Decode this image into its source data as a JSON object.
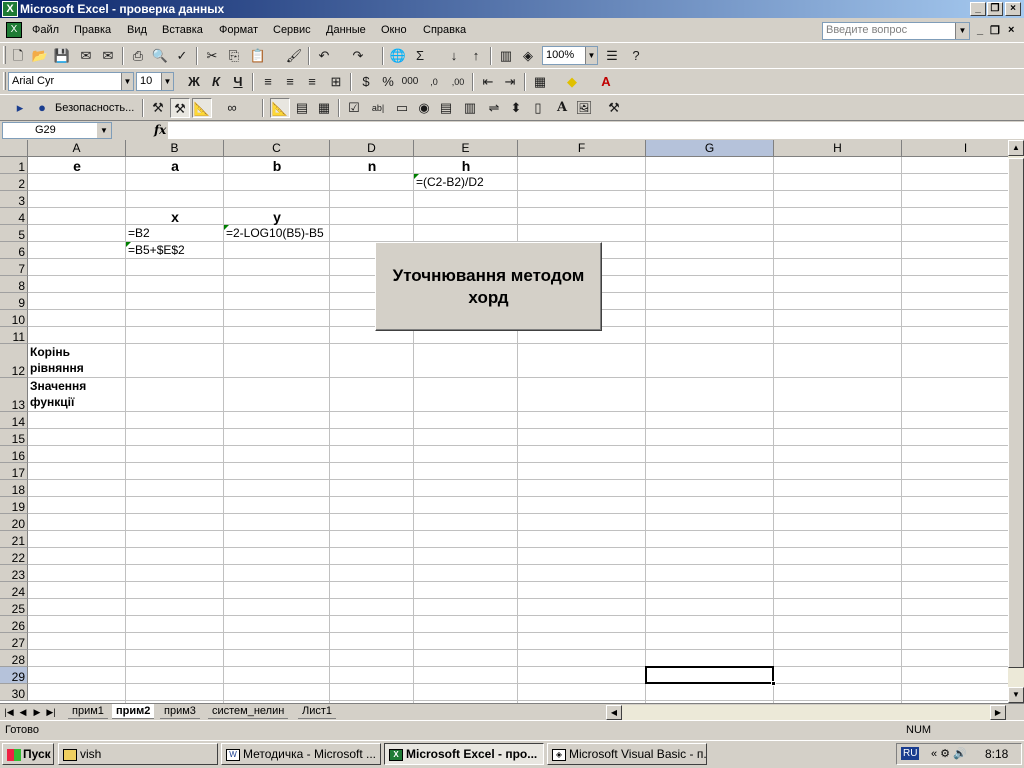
{
  "window": {
    "title": "Microsoft Excel - проверка данных"
  },
  "menu": {
    "items": [
      "Файл",
      "Правка",
      "Вид",
      "Вставка",
      "Формат",
      "Сервис",
      "Данные",
      "Окно",
      "Справка"
    ],
    "help_placeholder": "Введите вопрос"
  },
  "toolbar_standard": {
    "zoom": "100%"
  },
  "toolbar_format": {
    "font": "Arial Cyr",
    "size": "10",
    "bold": "Ж",
    "italic": "К",
    "underline": "Ч"
  },
  "toolbar_forms": {
    "security_label": "Безопасность..."
  },
  "formula_bar": {
    "name_box": "G29",
    "fx": "fx",
    "value": ""
  },
  "columns": [
    "A",
    "B",
    "C",
    "D",
    "E",
    "F",
    "G",
    "H",
    "I"
  ],
  "selected_column": "G",
  "rows": [
    "1",
    "2",
    "3",
    "4",
    "5",
    "6",
    "7",
    "8",
    "9",
    "10",
    "11",
    "12",
    "13",
    "14",
    "15",
    "16",
    "17",
    "18",
    "19",
    "20",
    "21",
    "22",
    "23",
    "24",
    "25",
    "26",
    "27",
    "28",
    "29",
    "30"
  ],
  "selected_row": "29",
  "cells": {
    "A1": "e",
    "B1": "a",
    "C1": "b",
    "D1": "n",
    "E1": "h",
    "E2": "=(C2-B2)/D2",
    "B4": "x",
    "C4": "y",
    "B5": "=B2",
    "C5": "=2-LOG10(B5)-B5",
    "B6": "=B5+$E$2",
    "A12": "Корінь рівняння",
    "A13": "Значення функції"
  },
  "sheet_button": {
    "label": "Уточнювання методом хорд"
  },
  "sheet_tabs": [
    "прим1",
    "прим2",
    "прим3",
    "систем_нелин",
    "Лист1"
  ],
  "active_tab": "прим2",
  "status": {
    "text": "Готово",
    "num": "NUM"
  },
  "taskbar": {
    "start": "Пуск",
    "tasks": [
      "vish",
      "Методичка - Microsoft ...",
      "Microsoft Excel - про...",
      "Microsoft Visual Basic - п..."
    ],
    "active_task": "Microsoft Excel - про...",
    "lang": "RU",
    "clock": "8:18"
  }
}
